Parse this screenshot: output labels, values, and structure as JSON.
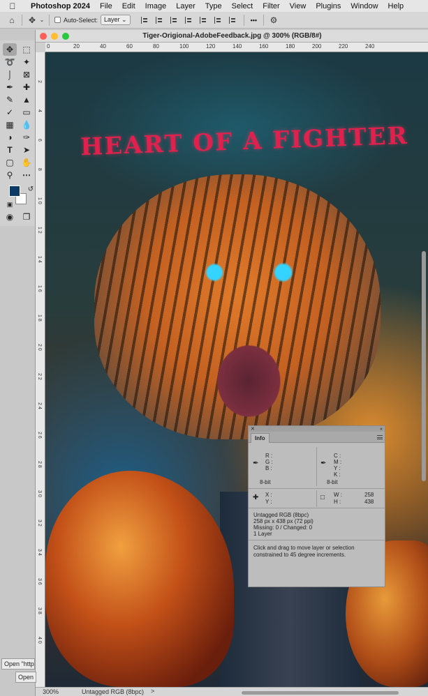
{
  "menubar": {
    "app_name": "Photoshop 2024",
    "items": [
      "File",
      "Edit",
      "Image",
      "Layer",
      "Type",
      "Select",
      "Filter",
      "View",
      "Plugins",
      "Window",
      "Help"
    ]
  },
  "options_bar": {
    "auto_select_label": "Auto-Select:",
    "auto_select_value": "Layer",
    "more_label": "•••"
  },
  "document": {
    "title": "Tiger-Origional-AdobeFeedback.jpg @ 300% (RGB/8#)",
    "ruler_h": [
      "0",
      "20",
      "40",
      "60",
      "80",
      "100",
      "120",
      "140",
      "160",
      "180",
      "200",
      "220",
      "240"
    ],
    "ruler_v": [
      "2",
      "4",
      "6",
      "8",
      "1 0",
      "1 2",
      "1 4",
      "1 6",
      "1 8",
      "2 0",
      "2 2",
      "2 4",
      "2 6",
      "2 8",
      "3 0",
      "3 2",
      "3 4",
      "3 6",
      "3 8",
      "4 0"
    ],
    "artwork_text": "HEART OF A FIGHTER"
  },
  "info_panel": {
    "tab_label": "Info",
    "rgb_labels": {
      "r": "R :",
      "g": "G :",
      "b": "B :"
    },
    "cmyk_labels": {
      "c": "C :",
      "m": "M :",
      "y": "Y :",
      "k": "K :"
    },
    "bit_left": "8-bit",
    "bit_right": "8-bit",
    "x_label": "X :",
    "y_label": "Y :",
    "w_label": "W :",
    "h_label": "H :",
    "w_value": "258",
    "h_value": "438",
    "doc_info": [
      "Untagged RGB (8bpc)",
      "258 px x 438 px (72 ppi)",
      "Missing: 0 / Changed: 0",
      "1 Layer"
    ],
    "hint": "Click and drag to move layer or selection constrained to 45 degree increments."
  },
  "status_bar": {
    "zoom": "300%",
    "profile": "Untagged RGB (8bpc)",
    "arrow": ">"
  },
  "tooltips": {
    "tip1": "Open \"http",
    "tip2": "Open "
  }
}
